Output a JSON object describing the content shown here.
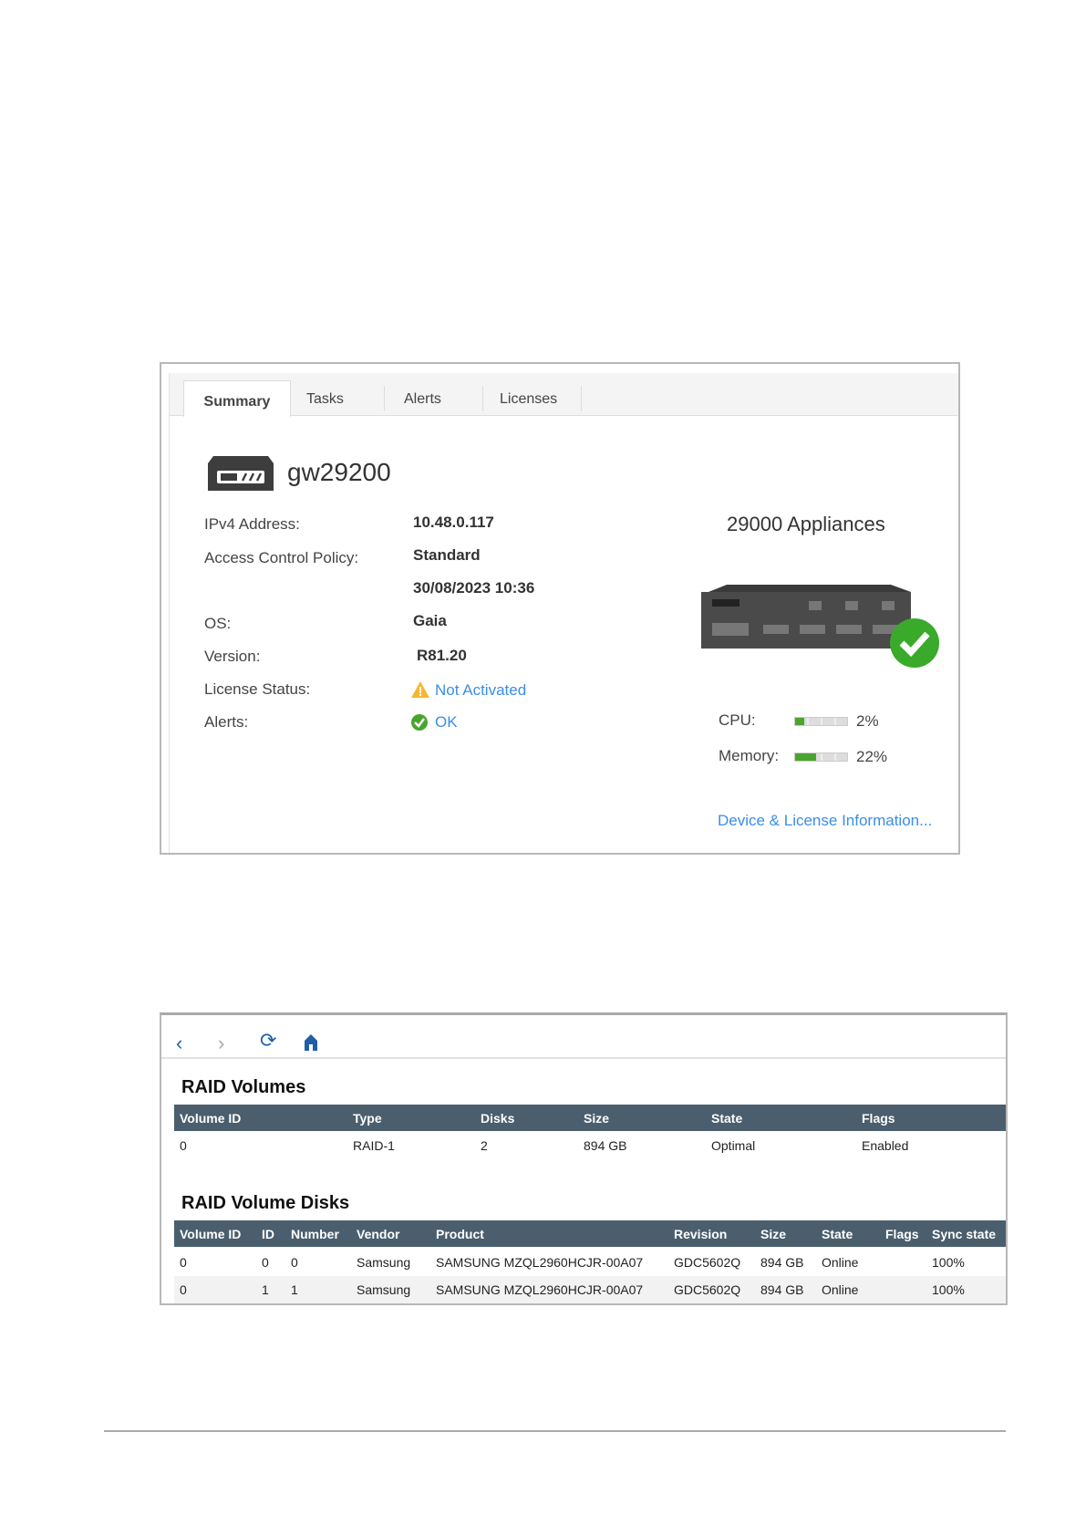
{
  "tabs": [
    "Summary",
    "Tasks",
    "Alerts",
    "Licenses"
  ],
  "device": {
    "name": "gw29200",
    "model": "29000 Appliances",
    "fields": [
      {
        "label": "IPv4 Address:",
        "value": "10.48.0.117"
      },
      {
        "label": "Access Control Policy:",
        "value": "Standard"
      },
      {
        "label": "",
        "value": "30/08/2023 10:36"
      },
      {
        "label": "OS:",
        "value": "Gaia"
      },
      {
        "label": "Version:",
        "value": "R81.20"
      }
    ],
    "license_label": "License Status:",
    "license_value": "Not Activated",
    "alerts_label": "Alerts:",
    "alerts_value": "OK",
    "cpu_label": "CPU:",
    "cpu_value": "2%",
    "cpu_fraction": 0.02,
    "memory_label": "Memory:",
    "memory_value": "22%",
    "memory_fraction": 0.22,
    "info_link": "Device & License Information..."
  },
  "colors": {
    "accent": "#3a8ee6",
    "header": "#4a5e6d",
    "ok": "#4aa52e"
  },
  "raid_volumes": {
    "title": "RAID Volumes",
    "columns": [
      "Volume ID",
      "Type",
      "Disks",
      "Size",
      "State",
      "Flags"
    ],
    "rows": [
      [
        "0",
        "RAID-1",
        "2",
        "894 GB",
        "Optimal",
        "Enabled"
      ]
    ]
  },
  "raid_disks": {
    "title": "RAID Volume Disks",
    "columns": [
      "Volume ID",
      "ID",
      "Number",
      "Vendor",
      "Product",
      "Revision",
      "Size",
      "State",
      "Flags",
      "Sync state"
    ],
    "rows": [
      [
        "0",
        "0",
        "0",
        "Samsung",
        "SAMSUNG MZQL2960HCJR-00A07",
        "GDC5602Q",
        "894 GB",
        "Online",
        "",
        "100%"
      ],
      [
        "0",
        "1",
        "1",
        "Samsung",
        "SAMSUNG MZQL2960HCJR-00A07",
        "GDC5602Q",
        "894 GB",
        "Online",
        "",
        "100%"
      ]
    ]
  }
}
